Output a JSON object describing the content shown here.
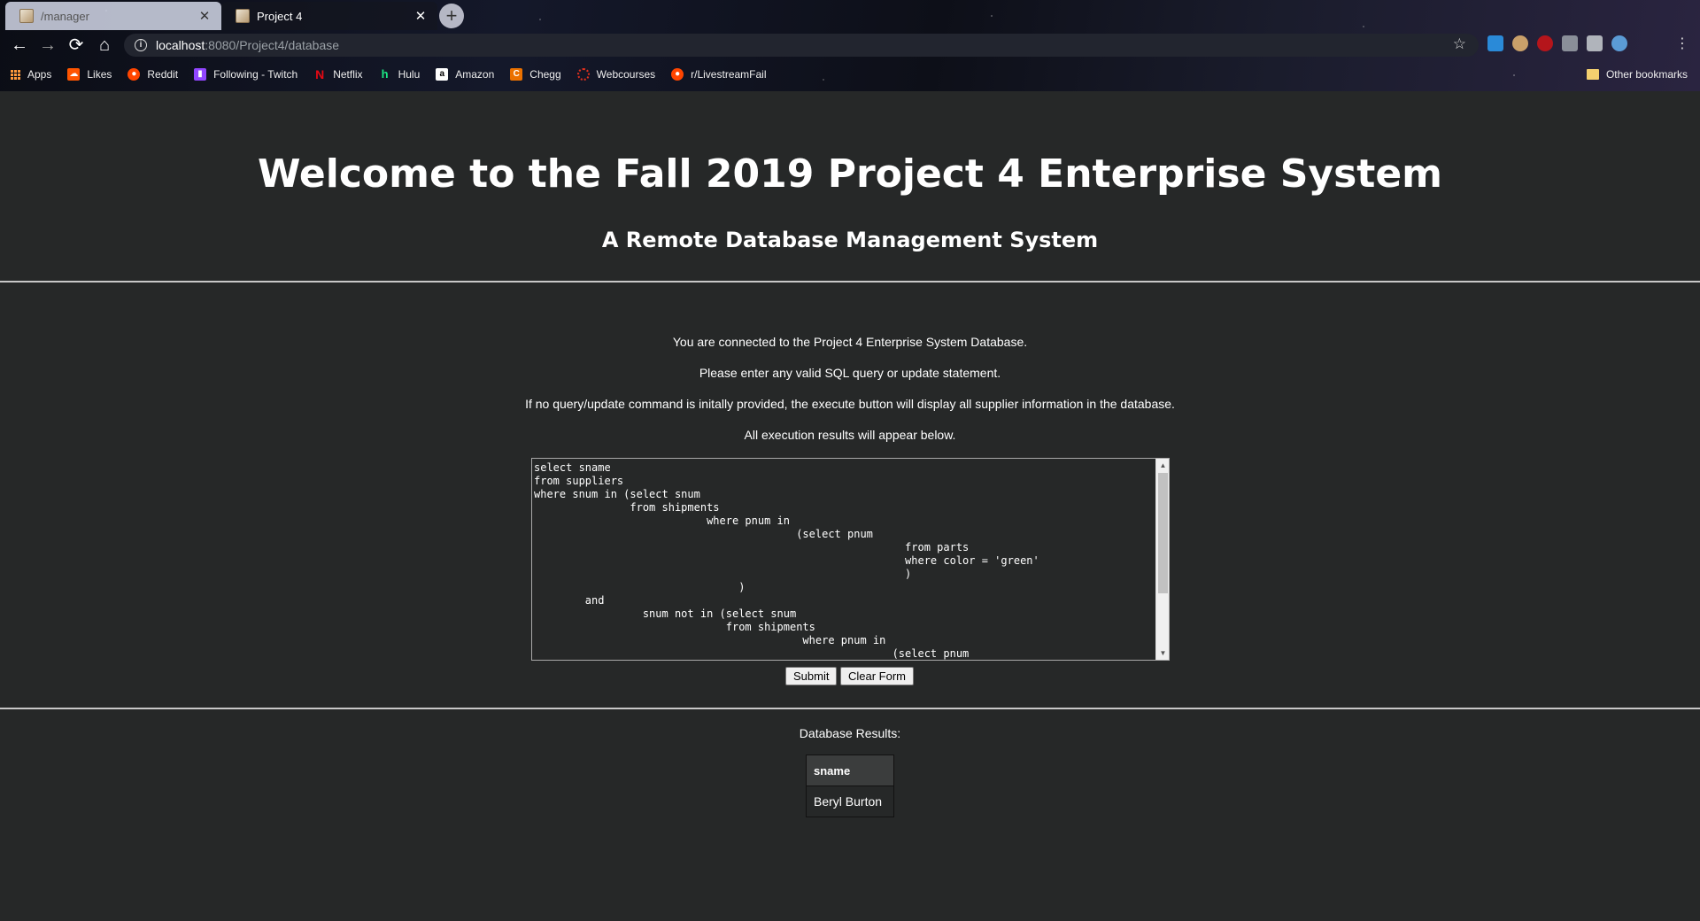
{
  "browser": {
    "tabs": [
      {
        "title": "/manager",
        "active": false
      },
      {
        "title": "Project 4",
        "active": true
      }
    ],
    "url_host": "localhost",
    "url_path": ":8080/Project4/database",
    "bookmarks": [
      {
        "label": "Apps",
        "icon": "apps-grid-icon"
      },
      {
        "label": "Likes",
        "icon": "soundcloud-icon"
      },
      {
        "label": "Reddit",
        "icon": "reddit-icon"
      },
      {
        "label": "Following - Twitch",
        "icon": "twitch-icon"
      },
      {
        "label": "Netflix",
        "icon": "netflix-icon"
      },
      {
        "label": "Hulu",
        "icon": "hulu-icon"
      },
      {
        "label": "Amazon",
        "icon": "amazon-icon"
      },
      {
        "label": "Chegg",
        "icon": "chegg-icon"
      },
      {
        "label": "Webcourses",
        "icon": "webcourses-icon"
      },
      {
        "label": "r/LivestreamFail",
        "icon": "reddit-icon"
      }
    ],
    "other_bookmarks": "Other bookmarks"
  },
  "page": {
    "title": "Welcome to the Fall 2019 Project 4 Enterprise System",
    "subtitle": "A Remote Database Management System",
    "info_lines": [
      "You are connected to the Project 4 Enterprise System Database.",
      "Please enter any valid SQL query or update statement.",
      "If no query/update command is initally provided, the execute button will display all supplier information in the database.",
      "All execution results will appear below."
    ],
    "sql_query": "select sname\nfrom suppliers\nwhere snum in (select snum\n               from shipments\n                           where pnum in\n                                         (select pnum\n                                                          from parts\n                                                          where color = 'green'\n                                                          )\n                                )\n        and\n                 snum not in (select snum\n                              from shipments\n                                          where pnum in\n                                                        (select pnum",
    "submit_label": "Submit",
    "clear_label": "Clear Form",
    "results_label": "Database Results:",
    "results": {
      "columns": [
        "sname"
      ],
      "rows": [
        [
          "Beryl Burton"
        ]
      ]
    }
  },
  "colors": {
    "background": "#262828",
    "text": "#ffffff",
    "rule": "#c8c8c8"
  }
}
